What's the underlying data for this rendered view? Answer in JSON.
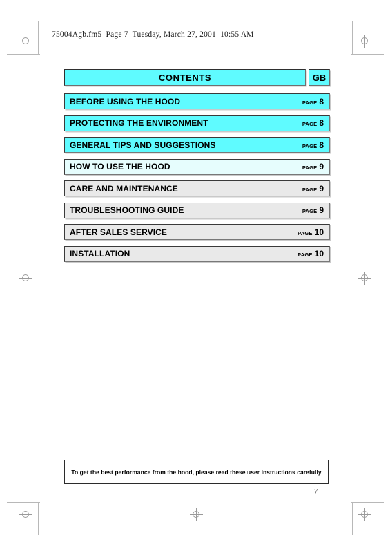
{
  "document": {
    "header_line": "75004Agb.fm5  Page 7  Tuesday, March 27, 2001  10:55 AM",
    "page_number": "7"
  },
  "contents": {
    "title": "CONTENTS",
    "language_code": "GB",
    "page_word": "PAGE",
    "entries": [
      {
        "label": "BEFORE USING THE HOOD",
        "page_word": "PAGE",
        "page": "8",
        "style": "cyan"
      },
      {
        "label": "PROTECTING THE ENVIRONMENT",
        "page_word": "PAGE",
        "page": "8",
        "style": "cyan"
      },
      {
        "label": "GENERAL TIPS AND SUGGESTIONS",
        "page_word": "PAGE",
        "page": "8",
        "style": "cyan"
      },
      {
        "label": "HOW TO USE THE HOOD",
        "page_word": "PAGE",
        "page": "9",
        "style": "pale"
      },
      {
        "label": "CARE AND MAINTENANCE",
        "page_word": "PAGE",
        "page": "9",
        "style": "grey"
      },
      {
        "label": "TROUBLESHOOTING GUIDE",
        "page_word": "PAGE",
        "page": "9",
        "style": "grey"
      },
      {
        "label": "AFTER SALES SERVICE",
        "page_word": "PAGE",
        "page": "10",
        "style": "grey"
      },
      {
        "label": "INSTALLATION",
        "page_word": "PAGE",
        "page": "10",
        "style": "grey"
      }
    ]
  },
  "footer": {
    "note": "To get the best performance from the hood, please read these user instructions carefully"
  },
  "colors": {
    "cyan": "#5ffbff",
    "pale_cyan": "#e6fdfd",
    "grey": "#e9e9e9",
    "text": "#000000"
  }
}
